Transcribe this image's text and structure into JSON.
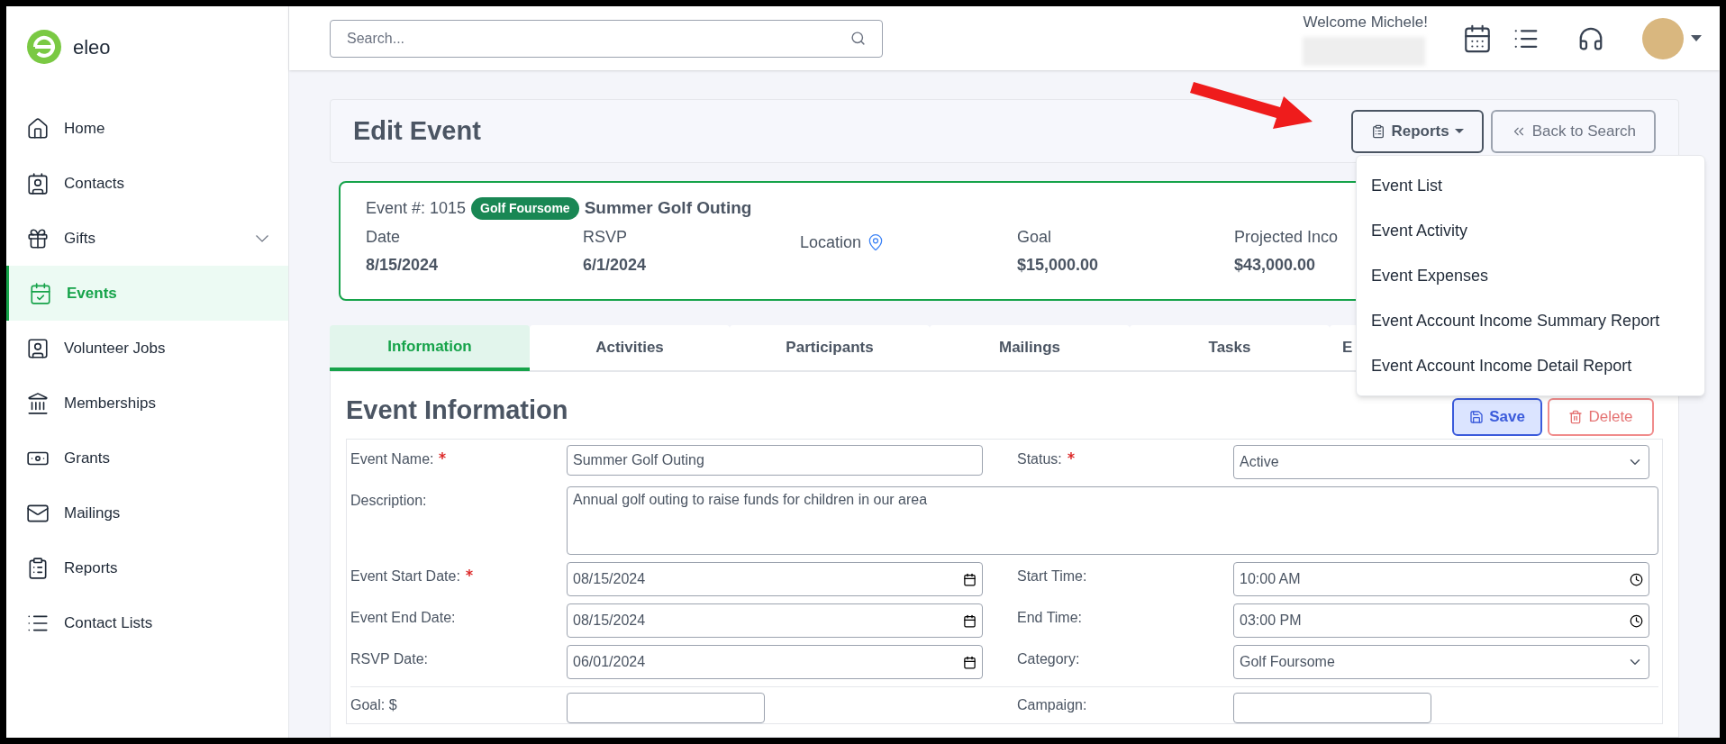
{
  "brand": {
    "name": "eleo"
  },
  "sidebar": {
    "items": [
      {
        "label": "Home",
        "selected": false,
        "submenu": false
      },
      {
        "label": "Contacts",
        "selected": false,
        "submenu": false
      },
      {
        "label": "Gifts",
        "selected": false,
        "submenu": true
      },
      {
        "label": "Events",
        "selected": true,
        "submenu": false
      },
      {
        "label": "Volunteer Jobs",
        "selected": false,
        "submenu": false
      },
      {
        "label": "Memberships",
        "selected": false,
        "submenu": false
      },
      {
        "label": "Grants",
        "selected": false,
        "submenu": false
      },
      {
        "label": "Mailings",
        "selected": false,
        "submenu": false
      },
      {
        "label": "Reports",
        "selected": false,
        "submenu": false
      },
      {
        "label": "Contact Lists",
        "selected": false,
        "submenu": false
      }
    ]
  },
  "topbar": {
    "search": {
      "placeholder": "Search..."
    },
    "welcome": "Welcome Michele!"
  },
  "page": {
    "title": "Edit Event",
    "reports_button": "Reports",
    "back_button": "Back to Search",
    "reports_menu": [
      "Event List",
      "Event Activity",
      "Event Expenses",
      "Event Account Income Summary Report",
      "Event Account Income Detail Report"
    ]
  },
  "event_card": {
    "number": "Event #: 1015",
    "tag": "Golf Foursome",
    "name": "Summer Golf Outing",
    "fields": [
      {
        "label": "Date",
        "value": "8/15/2024",
        "kind": "text"
      },
      {
        "label": "RSVP",
        "value": "6/1/2024",
        "kind": "text"
      },
      {
        "label": "Location",
        "kind": "location"
      },
      {
        "label": "Goal",
        "value": "$15,000.00",
        "kind": "text"
      },
      {
        "label": "Projected Inco",
        "value": "$43,000.00",
        "kind": "text"
      }
    ]
  },
  "tabs": [
    {
      "label": "Information",
      "selected": true
    },
    {
      "label": "Activities",
      "selected": false
    },
    {
      "label": "Participants",
      "selected": false
    },
    {
      "label": "Mailings",
      "selected": false
    },
    {
      "label": "Tasks",
      "selected": false
    },
    {
      "label": "E",
      "selected": false
    }
  ],
  "section": {
    "title": "Event Information",
    "save": "Save",
    "delete": "Delete"
  },
  "form": {
    "rows": [
      [
        {
          "label": "Event Name:",
          "required": true,
          "kind": "text",
          "value": "Summer Golf Outing"
        },
        {
          "label": "Status:",
          "required": true,
          "kind": "select",
          "value": "Active"
        }
      ],
      [
        {
          "label": "Description:",
          "required": false,
          "kind": "textarea",
          "value": "Annual golf outing to raise funds for children in our area"
        }
      ],
      [
        {
          "label": "Event Start Date:",
          "required": true,
          "kind": "date",
          "value": "08/15/2024"
        },
        {
          "label": "Start Time:",
          "required": false,
          "kind": "time",
          "value": "10:00 AM"
        }
      ],
      [
        {
          "label": "Event End Date:",
          "required": false,
          "kind": "date",
          "value": "08/15/2024"
        },
        {
          "label": "End Time:",
          "required": false,
          "kind": "time",
          "value": "03:00 PM"
        }
      ],
      [
        {
          "label": "RSVP Date:",
          "required": false,
          "kind": "date",
          "value": "06/01/2024"
        },
        {
          "label": "Category:",
          "required": false,
          "kind": "select",
          "value": "Golf Foursome"
        }
      ]
    ],
    "cut_row": [
      {
        "label": "Goal: $"
      },
      {
        "label": "Campaign:"
      }
    ]
  }
}
